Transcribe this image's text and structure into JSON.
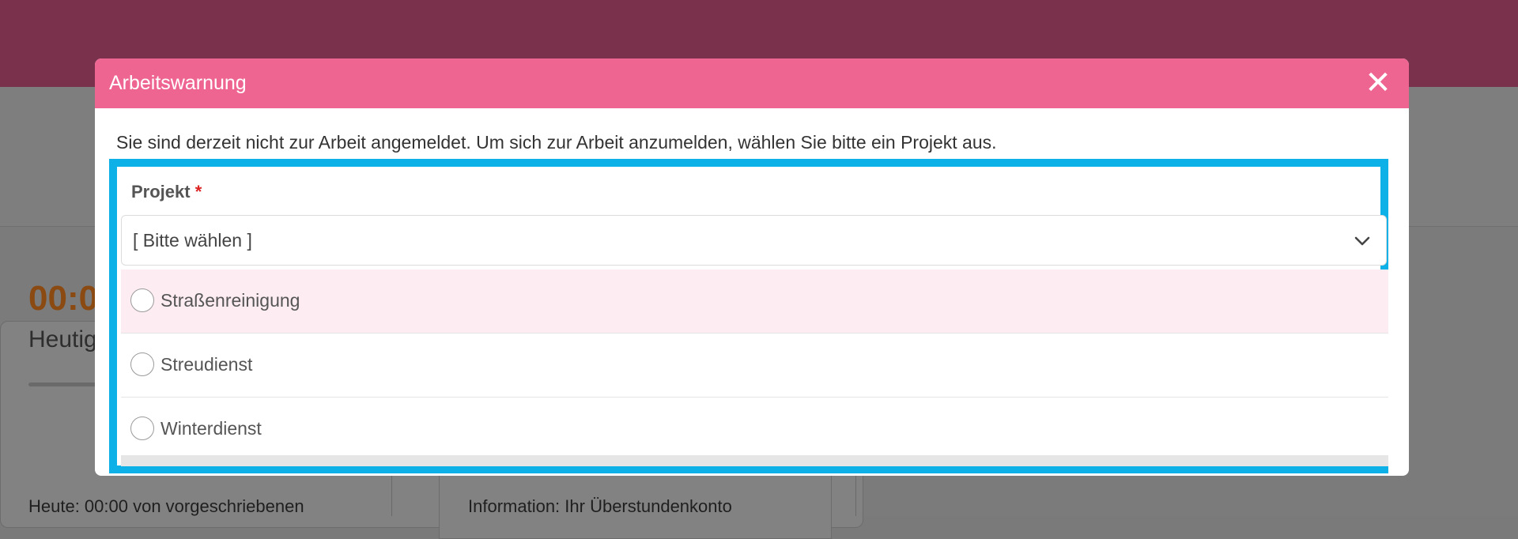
{
  "background": {
    "timer": "00:0",
    "heute_label": "Heutig",
    "today_info": "Heute: 00:00 von vorgeschriebenen",
    "overtime_info": "Information: Ihr Überstundenkonto"
  },
  "modal": {
    "title": "Arbeitswarnung",
    "close_glyph": "✕",
    "description": "Sie sind derzeit nicht zur Arbeit angemeldet. Um sich zur Arbeit anzumelden, wählen Sie bitte ein Projekt aus.",
    "field": {
      "label": "Projekt",
      "required_mark": "*",
      "placeholder": "[ Bitte wählen ]",
      "chevron_icon": "chevron-down-icon"
    },
    "options": [
      {
        "label": "Straßenreinigung",
        "hovered": true
      },
      {
        "label": "Streudienst",
        "hovered": false
      },
      {
        "label": "Winterdienst",
        "hovered": false
      }
    ]
  },
  "colors": {
    "topbar": "#7a314c",
    "modal_header": "#ef6592",
    "highlight_border": "#0db1e8",
    "option_hover": "#fdecf2",
    "timer": "#8a4a12"
  }
}
